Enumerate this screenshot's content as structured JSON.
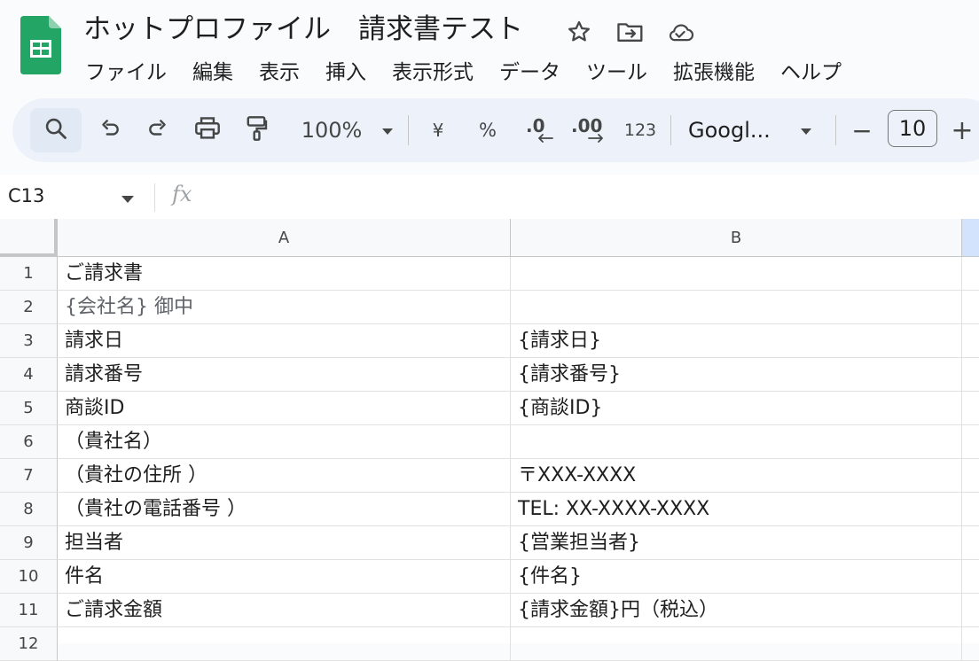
{
  "document": {
    "title": "ホットプロファイル　請求書テスト"
  },
  "menu": [
    "ファイル",
    "編集",
    "表示",
    "挿入",
    "表示形式",
    "データ",
    "ツール",
    "拡張機能",
    "ヘルプ"
  ],
  "toolbar": {
    "zoom": "100%",
    "currency": "¥",
    "percent": "%",
    "decrease_decimal": ".0",
    "increase_decimal": ".00",
    "number_format": "123",
    "font": "Googl...",
    "minus": "−",
    "font_size": "10",
    "plus": "+"
  },
  "formula_bar": {
    "cell_ref": "C13",
    "fx": "fx",
    "content": ""
  },
  "columns": [
    "A",
    "B"
  ],
  "rows": [
    {
      "num": "1",
      "a": "ご請求書",
      "b": ""
    },
    {
      "num": "2",
      "a": "{会社名} 御中",
      "b": ""
    },
    {
      "num": "3",
      "a": "請求日",
      "b": "{請求日}"
    },
    {
      "num": "4",
      "a": "請求番号",
      "b": "{請求番号}"
    },
    {
      "num": "5",
      "a": "商談ID",
      "b": " {商談ID}"
    },
    {
      "num": "6",
      "a": "（貴社名）",
      "b": ""
    },
    {
      "num": "7",
      "a": "（貴社の住所 ）",
      "b": "〒XXX-XXXX"
    },
    {
      "num": "8",
      "a": "（貴社の電話番号 ）",
      "b": "TEL: XX-XXXX-XXXX"
    },
    {
      "num": "9",
      "a": "担当者",
      "b": "{営業担当者}"
    },
    {
      "num": "10",
      "a": "件名",
      "b": "{件名}"
    },
    {
      "num": "11",
      "a": "ご請求金額",
      "b": "{請求金額}円（税込）"
    },
    {
      "num": "12",
      "a": "",
      "b": ""
    }
  ],
  "colors": {
    "sheets_green": "#0f9d58",
    "toolbar_bg": "#edf2fa",
    "selected_col": "#d3e3fd"
  }
}
